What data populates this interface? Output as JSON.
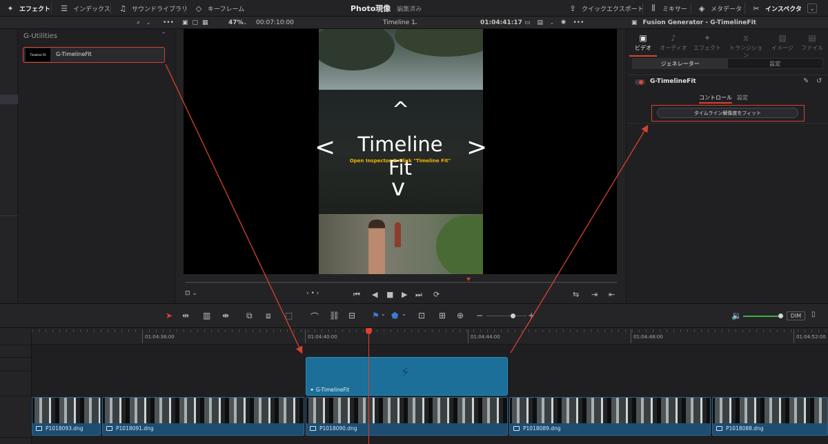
{
  "topbar": {
    "effects": "エフェクト",
    "index": "インデックス",
    "sound_library": "サウンドライブラリ",
    "keyframes": "キーフレーム",
    "title": "Photo現像",
    "subtitle": "編集済み",
    "quick_export": "クイックエクスポート",
    "mixer": "ミキサー",
    "metadata": "メタデータ",
    "inspector": "インスペクタ"
  },
  "viewer_bar": {
    "zoom": "47%",
    "duration": "00:07:10:00",
    "timeline_name": "Timeline 1",
    "timecode": "01:04:41:17",
    "inspector_title": "Fusion Generator - G-TimelineFit"
  },
  "effects_panel": {
    "header": "G-Utilities",
    "item_label": "G-TimelineFit",
    "thumb_text": "Timeline Fit"
  },
  "viewer": {
    "overlay_title": "Timeline Fit",
    "overlay_subtitle": "Open Inspector & Click \"Timeline Fit\"",
    "arrow_up": "^",
    "arrow_down": "v",
    "arrow_left": "<",
    "arrow_right": ">"
  },
  "inspector": {
    "tabs": [
      {
        "label": "ビデオ",
        "icon": "video-icon",
        "active": true
      },
      {
        "label": "オーディオ",
        "icon": "audio-icon",
        "active": false
      },
      {
        "label": "エフェクト",
        "icon": "effects-icon",
        "active": false
      },
      {
        "label": "トランジション",
        "icon": "transition-icon",
        "active": false
      },
      {
        "label": "イメージ",
        "icon": "image-icon",
        "active": false
      },
      {
        "label": "ファイル",
        "icon": "file-icon",
        "active": false
      }
    ],
    "segment": [
      "ジェネレーター",
      "設定"
    ],
    "generator_name": "G-TimelineFit",
    "subtabs": [
      "コントロール",
      "設定"
    ],
    "fit_button": "タイムライン解像度をフィット"
  },
  "timeline": {
    "dim_label": "DIM",
    "ruler": [
      "01:04:36:00",
      "01:04:40:00",
      "01:04:44:00",
      "01:04:48:00",
      "01:04:52:00"
    ],
    "generator_clip": "G-TimelineFit",
    "clips": [
      "P1018093.dng",
      "P1018091.dng",
      "P1018090.dng",
      "P1018089.dng",
      "P1018088.dng"
    ]
  },
  "colors": {
    "accent_red": "#d6432d",
    "generator_clip": "#1b6f98",
    "video_clip": "#1d4e72",
    "overlay_subtitle": "#f2b600"
  }
}
